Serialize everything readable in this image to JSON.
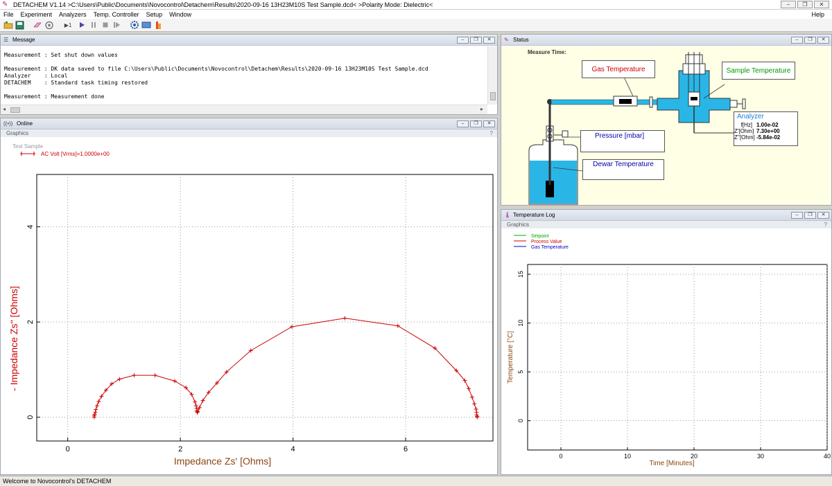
{
  "app": {
    "title": "DETACHEM V1.14 >C:\\Users\\Public\\Documents\\Novocontrol\\Detachem\\Results\\2020-09-16 13H23M10S Test Sample.dcd<    >Polarity Mode: Dielectric<",
    "icon": "detachem-logo-icon"
  },
  "menu": [
    "File",
    "Experiment",
    "Analyzers",
    "Temp. Controller",
    "Setup",
    "Window"
  ],
  "help": "Help",
  "toolbar": {
    "step_label": "▶1",
    "icons": [
      "open-folder-icon",
      "save-icon",
      "eraser-icon",
      "analyzer-icon",
      "step-icon",
      "play-icon",
      "pause-icon",
      "stop-icon",
      "skip-icon",
      "settings-icon",
      "monitor-icon",
      "cloud-icon"
    ]
  },
  "message_panel": {
    "title": "Message",
    "text": "Measurement : Set shut down values\n\nMeasurement : DK data saved to file C:\\Users\\Public\\Documents\\Novocontrol\\Detachem\\Results\\2020-09-16 13H23M10S Test Sample.dcd\nAnalyzer    : Local\nDETACHEM    : Standard task timing restored\n\nMeasurement : Measurement done"
  },
  "online_panel": {
    "title": "Online",
    "sub_title": "Graphics",
    "help_mark": "?",
    "sample_name": "Test Sample",
    "legend": "AC Volt  [Vrms]=1.0000e+00"
  },
  "colors": {
    "impedance": "#cc0000",
    "axis_label": "#8b4513",
    "y_label_red": "#cc0000",
    "setpoint": "#00aa00",
    "process_value": "#cc0000",
    "gas_temperature": "#0000cc",
    "vessel_blue": "#29b6e6"
  },
  "chart_data": [
    {
      "type": "scatter",
      "title": "",
      "xlabel": "Impedance Zs' [Ohms]",
      "ylabel": "- Impedance Zs'' [Ohms]",
      "xlim": [
        -0.55,
        7.55
      ],
      "ylim": [
        -0.5,
        5.1
      ],
      "xticks": [
        0,
        2,
        4,
        6
      ],
      "yticks": [
        0,
        2,
        4
      ],
      "grid": true,
      "series": [
        {
          "name": "AC Volt  [Vrms]=1.0000e+00",
          "x": [
            0.47,
            0.47,
            0.48,
            0.49,
            0.5,
            0.52,
            0.55,
            0.6,
            0.68,
            0.78,
            0.92,
            1.18,
            1.55,
            1.9,
            2.1,
            2.2,
            2.26,
            2.28,
            2.29,
            2.29,
            2.3,
            2.31,
            2.34,
            2.4,
            2.5,
            2.65,
            2.82,
            3.25,
            3.98,
            4.92,
            5.86,
            6.52,
            6.9,
            7.05,
            7.12,
            7.18,
            7.22,
            7.25,
            7.26,
            7.26,
            7.27,
            7.27
          ],
          "y": [
            0.0,
            0.03,
            0.06,
            0.1,
            0.16,
            0.24,
            0.33,
            0.44,
            0.57,
            0.7,
            0.8,
            0.88,
            0.88,
            0.76,
            0.62,
            0.48,
            0.32,
            0.24,
            0.18,
            0.13,
            0.1,
            0.12,
            0.2,
            0.35,
            0.52,
            0.72,
            0.95,
            1.4,
            1.9,
            2.08,
            1.92,
            1.45,
            0.98,
            0.77,
            0.6,
            0.42,
            0.28,
            0.17,
            0.1,
            0.05,
            0.02,
            0.0
          ]
        }
      ]
    },
    {
      "type": "line",
      "title": "",
      "xlabel": "Time [Minutes]",
      "ylabel": "Temperature [°C]",
      "xlim": [
        -5,
        40
      ],
      "ylim": [
        -3,
        16
      ],
      "xticks": [
        0,
        10,
        20,
        30,
        40
      ],
      "yticks": [
        0,
        5,
        10,
        15
      ],
      "grid": true,
      "series": [
        {
          "name": "Setpoint",
          "x": [],
          "y": []
        },
        {
          "name": "Process Value",
          "x": [],
          "y": []
        },
        {
          "name": "Gas Temperature",
          "x": [],
          "y": []
        }
      ]
    }
  ],
  "status_panel": {
    "title": "Status",
    "measure_time": "Measure Time:",
    "gas_temperature": "Gas Temperature",
    "sample_temperature": "Sample Temperature",
    "pressure": "Pressure [mbar]",
    "dewar_temperature": "Dewar Temperature",
    "analyzer": {
      "title": "Analyzer",
      "rows": [
        {
          "unit": "f[Hz]",
          "value": "1.00e-02"
        },
        {
          "unit": "Z'[Ohm]",
          "value": "7.30e+00"
        },
        {
          "unit": "Z''[Ohm]",
          "value": "-5.84e-02"
        }
      ]
    }
  },
  "temp_panel": {
    "title": "Temperature Log",
    "sub_title": "Graphics",
    "help_mark": "?",
    "legend": [
      "Setpoint",
      "Process Value",
      "Gas Temperature"
    ]
  },
  "statusbar": "Welcome to Novocontrol's DETACHEM"
}
